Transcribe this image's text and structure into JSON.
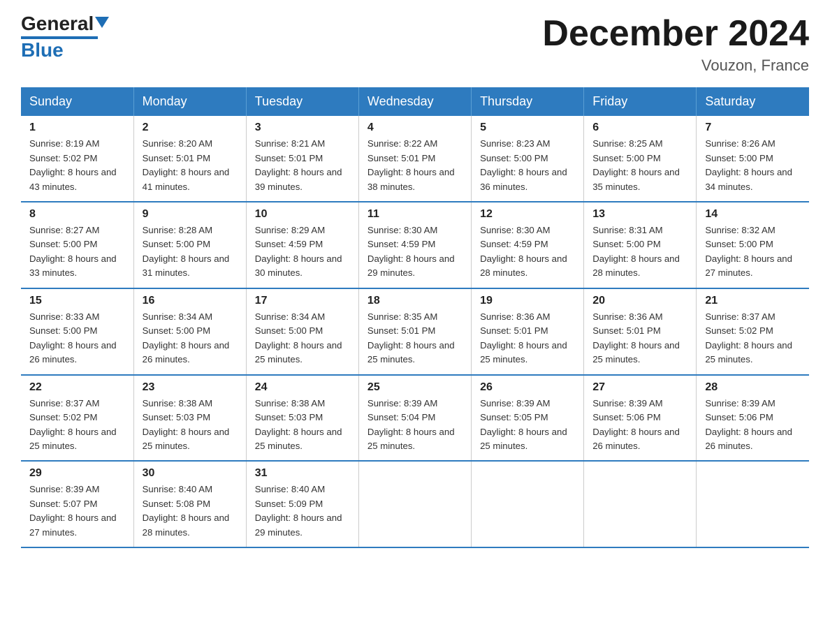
{
  "logo": {
    "general": "General",
    "blue": "Blue"
  },
  "title": "December 2024",
  "location": "Vouzon, France",
  "days_of_week": [
    "Sunday",
    "Monday",
    "Tuesday",
    "Wednesday",
    "Thursday",
    "Friday",
    "Saturday"
  ],
  "weeks": [
    [
      {
        "day": "1",
        "sunrise": "8:19 AM",
        "sunset": "5:02 PM",
        "daylight": "8 hours and 43 minutes."
      },
      {
        "day": "2",
        "sunrise": "8:20 AM",
        "sunset": "5:01 PM",
        "daylight": "8 hours and 41 minutes."
      },
      {
        "day": "3",
        "sunrise": "8:21 AM",
        "sunset": "5:01 PM",
        "daylight": "8 hours and 39 minutes."
      },
      {
        "day": "4",
        "sunrise": "8:22 AM",
        "sunset": "5:01 PM",
        "daylight": "8 hours and 38 minutes."
      },
      {
        "day": "5",
        "sunrise": "8:23 AM",
        "sunset": "5:00 PM",
        "daylight": "8 hours and 36 minutes."
      },
      {
        "day": "6",
        "sunrise": "8:25 AM",
        "sunset": "5:00 PM",
        "daylight": "8 hours and 35 minutes."
      },
      {
        "day": "7",
        "sunrise": "8:26 AM",
        "sunset": "5:00 PM",
        "daylight": "8 hours and 34 minutes."
      }
    ],
    [
      {
        "day": "8",
        "sunrise": "8:27 AM",
        "sunset": "5:00 PM",
        "daylight": "8 hours and 33 minutes."
      },
      {
        "day": "9",
        "sunrise": "8:28 AM",
        "sunset": "5:00 PM",
        "daylight": "8 hours and 31 minutes."
      },
      {
        "day": "10",
        "sunrise": "8:29 AM",
        "sunset": "4:59 PM",
        "daylight": "8 hours and 30 minutes."
      },
      {
        "day": "11",
        "sunrise": "8:30 AM",
        "sunset": "4:59 PM",
        "daylight": "8 hours and 29 minutes."
      },
      {
        "day": "12",
        "sunrise": "8:30 AM",
        "sunset": "4:59 PM",
        "daylight": "8 hours and 28 minutes."
      },
      {
        "day": "13",
        "sunrise": "8:31 AM",
        "sunset": "5:00 PM",
        "daylight": "8 hours and 28 minutes."
      },
      {
        "day": "14",
        "sunrise": "8:32 AM",
        "sunset": "5:00 PM",
        "daylight": "8 hours and 27 minutes."
      }
    ],
    [
      {
        "day": "15",
        "sunrise": "8:33 AM",
        "sunset": "5:00 PM",
        "daylight": "8 hours and 26 minutes."
      },
      {
        "day": "16",
        "sunrise": "8:34 AM",
        "sunset": "5:00 PM",
        "daylight": "8 hours and 26 minutes."
      },
      {
        "day": "17",
        "sunrise": "8:34 AM",
        "sunset": "5:00 PM",
        "daylight": "8 hours and 25 minutes."
      },
      {
        "day": "18",
        "sunrise": "8:35 AM",
        "sunset": "5:01 PM",
        "daylight": "8 hours and 25 minutes."
      },
      {
        "day": "19",
        "sunrise": "8:36 AM",
        "sunset": "5:01 PM",
        "daylight": "8 hours and 25 minutes."
      },
      {
        "day": "20",
        "sunrise": "8:36 AM",
        "sunset": "5:01 PM",
        "daylight": "8 hours and 25 minutes."
      },
      {
        "day": "21",
        "sunrise": "8:37 AM",
        "sunset": "5:02 PM",
        "daylight": "8 hours and 25 minutes."
      }
    ],
    [
      {
        "day": "22",
        "sunrise": "8:37 AM",
        "sunset": "5:02 PM",
        "daylight": "8 hours and 25 minutes."
      },
      {
        "day": "23",
        "sunrise": "8:38 AM",
        "sunset": "5:03 PM",
        "daylight": "8 hours and 25 minutes."
      },
      {
        "day": "24",
        "sunrise": "8:38 AM",
        "sunset": "5:03 PM",
        "daylight": "8 hours and 25 minutes."
      },
      {
        "day": "25",
        "sunrise": "8:39 AM",
        "sunset": "5:04 PM",
        "daylight": "8 hours and 25 minutes."
      },
      {
        "day": "26",
        "sunrise": "8:39 AM",
        "sunset": "5:05 PM",
        "daylight": "8 hours and 25 minutes."
      },
      {
        "day": "27",
        "sunrise": "8:39 AM",
        "sunset": "5:06 PM",
        "daylight": "8 hours and 26 minutes."
      },
      {
        "day": "28",
        "sunrise": "8:39 AM",
        "sunset": "5:06 PM",
        "daylight": "8 hours and 26 minutes."
      }
    ],
    [
      {
        "day": "29",
        "sunrise": "8:39 AM",
        "sunset": "5:07 PM",
        "daylight": "8 hours and 27 minutes."
      },
      {
        "day": "30",
        "sunrise": "8:40 AM",
        "sunset": "5:08 PM",
        "daylight": "8 hours and 28 minutes."
      },
      {
        "day": "31",
        "sunrise": "8:40 AM",
        "sunset": "5:09 PM",
        "daylight": "8 hours and 29 minutes."
      },
      {
        "day": "",
        "sunrise": "",
        "sunset": "",
        "daylight": ""
      },
      {
        "day": "",
        "sunrise": "",
        "sunset": "",
        "daylight": ""
      },
      {
        "day": "",
        "sunrise": "",
        "sunset": "",
        "daylight": ""
      },
      {
        "day": "",
        "sunrise": "",
        "sunset": "",
        "daylight": ""
      }
    ]
  ]
}
